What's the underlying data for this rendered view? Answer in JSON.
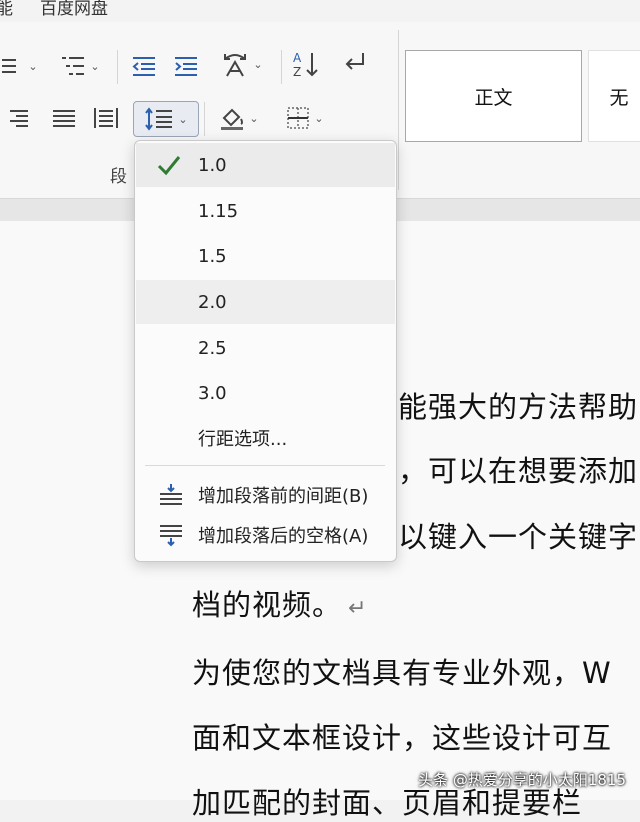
{
  "menu": {
    "item1": "能",
    "item2": "百度网盘"
  },
  "ribbon": {
    "group_label": "段",
    "style_normal": "正文",
    "style_next": "无"
  },
  "line_spacing_menu": {
    "options": [
      "1.0",
      "1.15",
      "1.5",
      "2.0",
      "2.5",
      "3.0"
    ],
    "selected": "1.0",
    "more_options": "行距选项...",
    "add_space_before": "增加段落前的间距(B)",
    "add_space_after": "增加段落后的空格(A)"
  },
  "document": {
    "lines": [
      "能强大的方法帮助",
      "，可以在想要添加",
      "以键入一个关键字",
      "档的视频。",
      "为使您的文档具有专业外观，W",
      "面和文本框设计，这些设计可互",
      "加匹配的封面、页眉和提要栏"
    ]
  },
  "watermark": "头条 @热爱分享的小太阳1815",
  "colors": {
    "check": "#2e7d32",
    "accent_border": "#9aa6b5"
  }
}
